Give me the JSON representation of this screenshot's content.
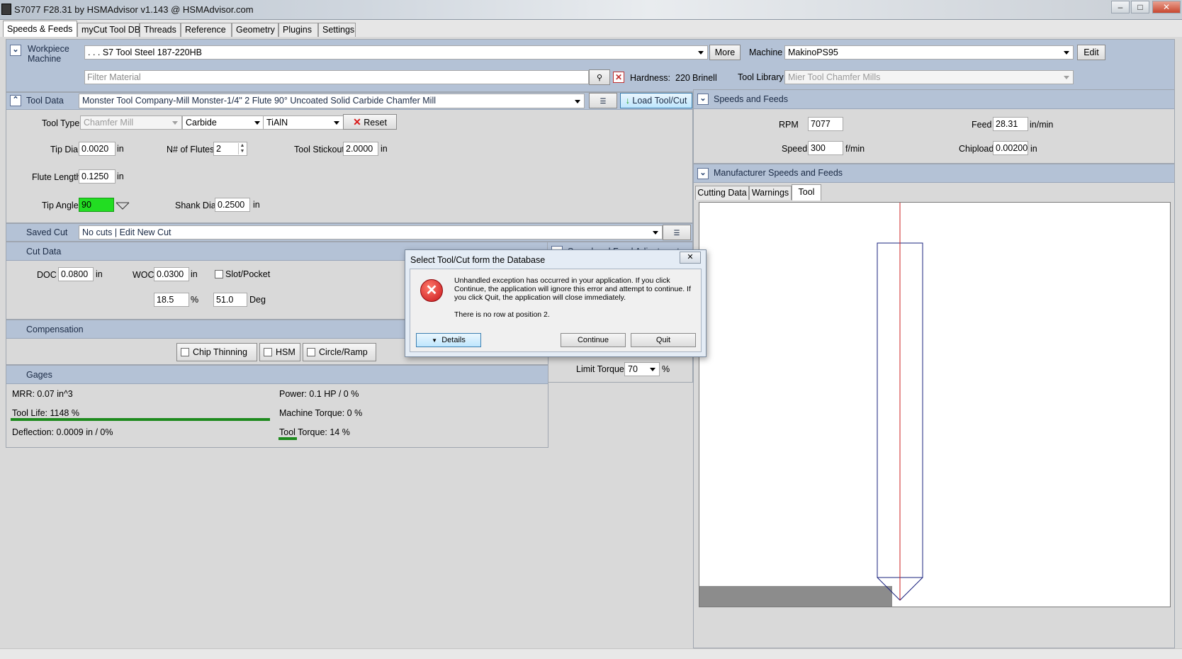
{
  "window": {
    "title": "S7077 F28.31 by HSMAdvisor v1.143 @ HSMAdvisor.com",
    "controls": [
      "–",
      "□",
      "✕"
    ]
  },
  "tabs": [
    {
      "label": "Speeds & Feeds"
    },
    {
      "label": "myCut Tool DB"
    },
    {
      "label": "Threads"
    },
    {
      "label": "Reference"
    },
    {
      "label": "Geometry"
    },
    {
      "label": "Plugins"
    },
    {
      "label": "Settings"
    }
  ],
  "workpiece": {
    "label_line1": "Workpiece",
    "label_line2": "Machine",
    "material": ". . . S7 Tool Steel 187-220HB",
    "more_label": "More",
    "machine_label": "Machine",
    "machine": "MakinoPS95",
    "edit_label": "Edit",
    "filter_placeholder": "Filter Material",
    "hardness_label": "Hardness:",
    "hardness_value": "220",
    "hardness_unit": "Brinell",
    "tool_library_label": "Tool Library",
    "tool_library": "Mier Tool Chamfer Mills"
  },
  "tool_data": {
    "header": "Tool Data",
    "tool_name": "Monster Tool Company-Mill Monster-1/4\" 2 Flute 90° Uncoated Solid Carbide Chamfer Mill",
    "load_label": "Load Tool/Cut",
    "tool_type_label": "Tool Type",
    "tool_type": "Chamfer Mill",
    "material": "Carbide",
    "coating": "TiAlN",
    "reset_label": "Reset",
    "tip_dia_label": "Tip Dia",
    "tip_dia": "0.0020",
    "flutes_label": "N# of Flutes",
    "flutes": "2",
    "stickout_label": "Tool Stickout",
    "stickout": "2.0000",
    "flute_length_label": "Flute Length",
    "flute_length": "0.1250",
    "tip_angle_label": "Tip Angle",
    "tip_angle": "90",
    "shank_dia_label": "Shank Dia",
    "shank_dia": "0.2500",
    "unit": "in"
  },
  "saved_cut": {
    "label": "Saved Cut",
    "value": "No cuts | Edit New Cut"
  },
  "cut_data": {
    "header": "Cut Data",
    "doc_label": "DOC",
    "doc": "0.0800",
    "woc_label": "WOC",
    "woc": "0.0300",
    "slot_label": "Slot/Pocket",
    "pct": "18.5",
    "pct_unit": "%",
    "deg": "51.0",
    "deg_unit": "Deg",
    "unit": "in"
  },
  "compensation": {
    "header": "Compensation",
    "chip_thinning": "Chip Thinning",
    "hsm": "HSM",
    "circle_ramp": "Circle/Ramp"
  },
  "adjustments": {
    "header": "Speed and Feed Adjustments",
    "limit_torque_label": "Limit Torque",
    "limit_torque": "70",
    "unit": "%"
  },
  "gages": {
    "header": "Gages",
    "mrr": "MRR: 0.07 in^3",
    "power": "Power: 0.1 HP / 0 %",
    "tool_life": "Tool Life: 1148 %",
    "tool_life_pct": 1.0,
    "machine_torque": "Machine Torque: 0 %",
    "deflection": "Deflection: 0.0009 in / 0%",
    "tool_torque": "Tool Torque: 14 %",
    "tool_torque_pct": 0.14
  },
  "speeds_feeds": {
    "header": "Speeds and Feeds",
    "rpm_label": "RPM",
    "rpm": "7077",
    "feed_label": "Feed",
    "feed": "28.31",
    "feed_unit": "in/min",
    "speed_label": "Speed",
    "speed": "300",
    "speed_unit": "f/min",
    "chipload_label": "Chipload",
    "chipload": "0.00200",
    "chipload_unit": "in"
  },
  "manufacturer": {
    "header": "Manufacturer Speeds and Feeds",
    "tabs": [
      "Cutting Data",
      "Warnings",
      "Tool"
    ]
  },
  "dialog": {
    "title": "Select Tool/Cut form the Database",
    "message": "Unhandled exception has occurred in your application. If you click Continue, the application will ignore this error and attempt to continue. If you click Quit, the application will close immediately.",
    "detail": "There is no row at position 2.",
    "details_label": "Details",
    "continue_label": "Continue",
    "quit_label": "Quit"
  },
  "colors": {
    "header_bg": "#b4c2d6",
    "tip_angle_bg": "#22dd22",
    "gauge_green": "#1e8a1e",
    "tool_center_line": "#cc2222",
    "tool_outline": "#1a237e"
  }
}
